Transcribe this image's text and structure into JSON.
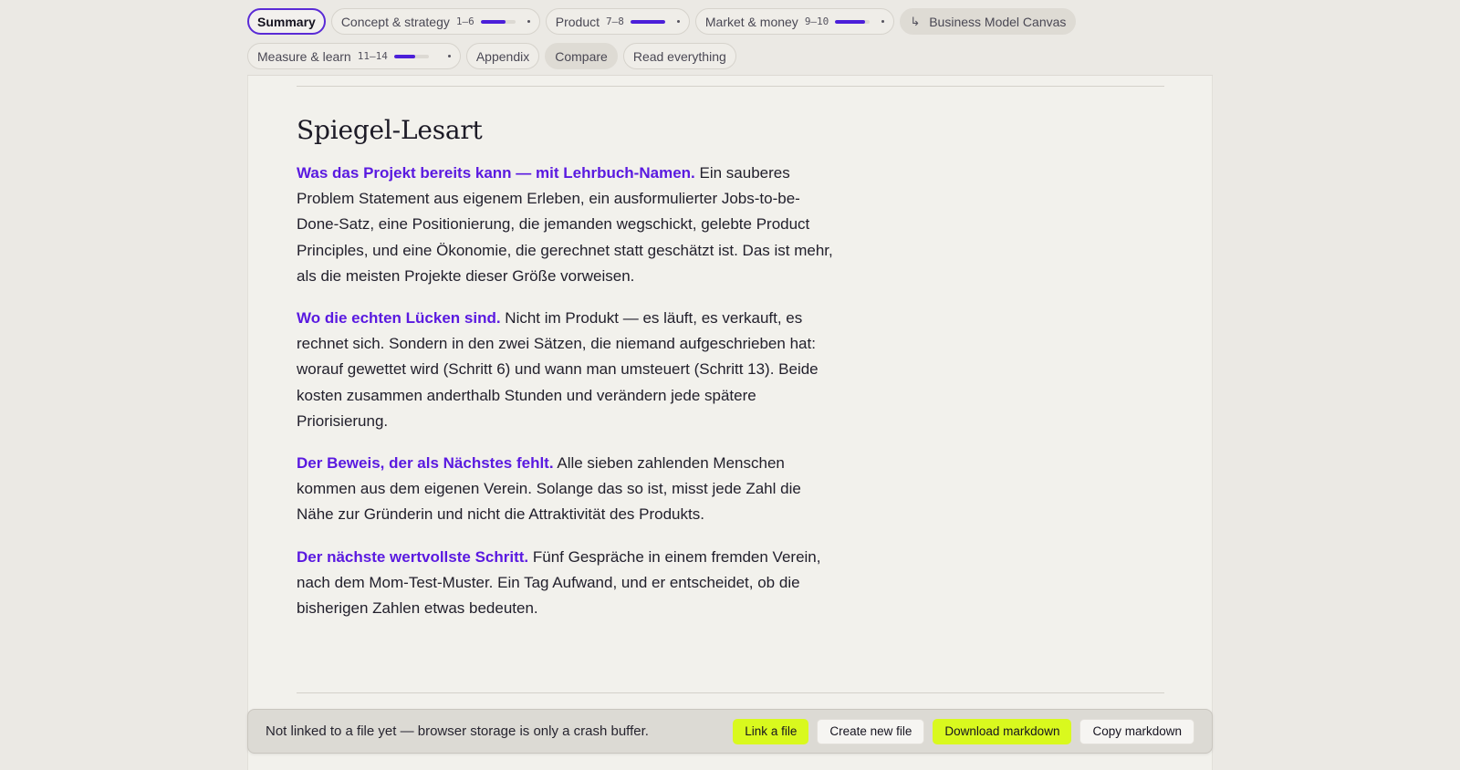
{
  "nav": {
    "row1": [
      {
        "label": "Summary",
        "active": true
      },
      {
        "label": "Concept & strategy",
        "range": "1–6",
        "progress": 0.72
      },
      {
        "label": "Product",
        "range": "7–8",
        "progress": 1.0
      },
      {
        "label": "Market & money",
        "range": "9–10",
        "progress": 0.85
      },
      {
        "label": "Business Model Canvas",
        "arrow": "↳"
      }
    ],
    "row2": [
      {
        "label": "Measure & learn",
        "range": "11–14",
        "progress": 0.6
      },
      {
        "label": "Appendix"
      },
      {
        "label": "Compare"
      },
      {
        "label": "Read everything"
      }
    ]
  },
  "doc": {
    "heading": "Spiegel-Lesart",
    "paragraphs": [
      {
        "lead": "Was das Projekt bereits kann — mit Lehrbuch-Namen.",
        "text": "Ein sauberes Problem Statement aus eigenem Erleben, ein ausformulierter Jobs-to-be-Done-Satz, eine Positionierung, die jemanden wegschickt, gelebte Product Principles, und eine Ökonomie, die gerechnet statt geschätzt ist. Das ist mehr, als die meisten Projekte dieser Größe vorweisen."
      },
      {
        "lead": "Wo die echten Lücken sind.",
        "text": "Nicht im Produkt — es läuft, es verkauft, es rechnet sich. Sondern in den zwei Sätzen, die niemand aufgeschrieben hat: worauf gewettet wird (Schritt 6) und wann man umsteuert (Schritt 13). Beide kosten zusammen anderthalb Stunden und verändern jede spätere Priorisierung."
      },
      {
        "lead": "Der Beweis, der als Nächstes fehlt.",
        "text": "Alle sieben zahlenden Menschen kommen aus dem eigenen Verein. Solange das so ist, misst jede Zahl die Nähe zur Gründerin und nicht die Attraktivität des Produkts."
      },
      {
        "lead": "Der nächste wertvollste Schritt.",
        "text": "Fünf Gespräche in einem fremden Verein, nach dem Mom-Test-Muster. Ein Tag Aufwand, und er entscheidet, ob die bisherigen Zahlen etwas bedeuten."
      }
    ]
  },
  "bottombar": {
    "message": "Not linked to a file yet — browser storage is only a crash buffer.",
    "link_file": "Link a file",
    "create_file": "Create new file",
    "download_markdown": "Download markdown",
    "copy_markdown": "Copy markdown"
  },
  "colors": {
    "accent_purple": "#5a1ae0",
    "progress": "#4b1fd9",
    "accent_yellow": "#d9f91e"
  }
}
